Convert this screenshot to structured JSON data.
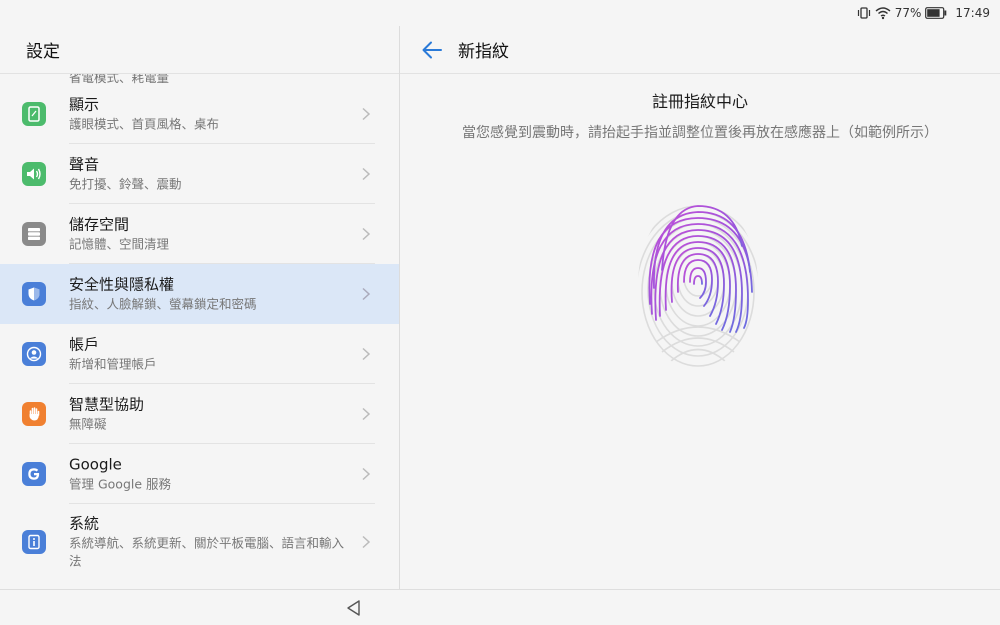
{
  "status_bar": {
    "battery": "77%",
    "time": "17:49"
  },
  "settings": {
    "title": "設定",
    "partial_item_sub": "省電模式、耗電量",
    "items": [
      {
        "title": "顯示",
        "sub": "護眼模式、首頁風格、桌布",
        "icon": "display-icon",
        "color": "#4cbb6c"
      },
      {
        "title": "聲音",
        "sub": "免打擾、鈴聲、震動",
        "icon": "sound-icon",
        "color": "#4cbb6c"
      },
      {
        "title": "儲存空間",
        "sub": "記憶體、空間清理",
        "icon": "storage-icon",
        "color": "#8a8a8a"
      },
      {
        "title": "安全性與隱私權",
        "sub": "指紋、人臉解鎖、螢幕鎖定和密碼",
        "icon": "shield-icon",
        "color": "#4a7fd8"
      },
      {
        "title": "帳戶",
        "sub": "新增和管理帳戶",
        "icon": "account-icon",
        "color": "#4a7fd8"
      },
      {
        "title": "智慧型協助",
        "sub": "無障礙",
        "icon": "hand-icon",
        "color": "#f08030"
      },
      {
        "title": "Google",
        "sub": "管理 Google 服務",
        "icon": "google-icon",
        "color": "#4a7fd8"
      },
      {
        "title": "系統",
        "sub": "系統導航、系統更新、關於平板電腦、語言和輸入法",
        "icon": "info-icon",
        "color": "#4a7fd8"
      }
    ]
  },
  "detail": {
    "title": "新指紋",
    "enroll_title": "註冊指紋中心",
    "enroll_desc": "當您感覺到震動時，請抬起手指並調整位置後再放在感應器上（如範例所示）"
  },
  "colors": {
    "accent": "#2a7ad8",
    "selected_bg": "#dbe7f7",
    "fingerprint_active": "#a050d8",
    "fingerprint_inactive": "#dcdcdc"
  }
}
